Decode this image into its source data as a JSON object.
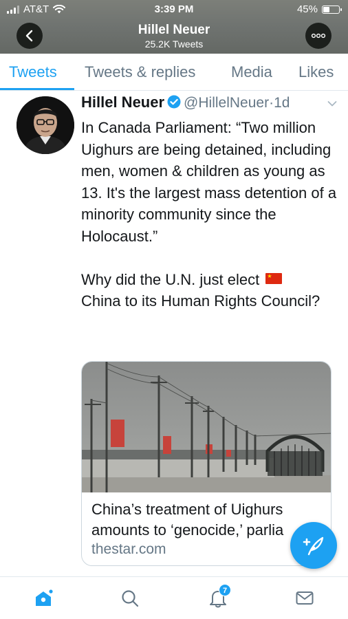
{
  "status_bar": {
    "carrier": "AT&T",
    "time": "3:39 PM",
    "battery": "45%",
    "battery_level": 0.45,
    "icons": [
      "signal-bars-icon",
      "wifi-icon",
      "battery-icon"
    ]
  },
  "header": {
    "title": "Hillel Neuer",
    "subtitle": "25.2K Tweets",
    "back_icon": "chevron-left-icon",
    "more_icon": "more-options-icon"
  },
  "tabs": [
    {
      "label": "Tweets",
      "active": true
    },
    {
      "label": "Tweets & replies",
      "active": false
    },
    {
      "label": "Media",
      "active": false
    },
    {
      "label": "Likes",
      "active": false
    }
  ],
  "tweet": {
    "author_name": "Hillel Neuer",
    "verified": true,
    "handle": "@HillelNeuer",
    "separator": "·",
    "time_ago": "1d",
    "text_para1": "In Canada Parliament: “Two million Uighurs are being detained, including men, women & children as young as 13. It's the largest mass detention of a minority community since the Holocaust.”",
    "text_para2": "Why did the U.N. just elect",
    "text_para2_rest": "China to its Human Rights Council?",
    "emoji": "china-flag",
    "link_card": {
      "title": "China’s treatment of Uighurs amounts to ‘genocide,’ parlia",
      "domain": "thestar.com"
    }
  },
  "fab": {
    "icon": "compose-tweet-icon"
  },
  "bottom_nav": {
    "items": [
      {
        "name": "home-icon",
        "active": true
      },
      {
        "name": "search-icon",
        "active": false
      },
      {
        "name": "notifications-icon",
        "active": false,
        "badge": "7"
      },
      {
        "name": "messages-icon",
        "active": false
      }
    ]
  },
  "colors": {
    "accent": "#1da1f2",
    "header_bg": "#6f7370",
    "text_primary": "#14171a",
    "text_secondary": "#657786",
    "border": "#e1e8ed"
  }
}
